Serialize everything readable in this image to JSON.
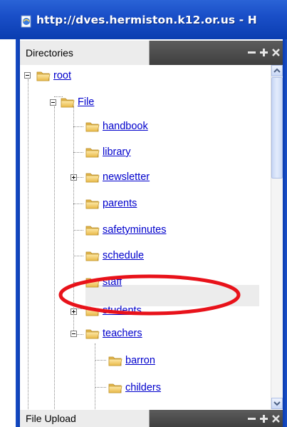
{
  "window": {
    "title": "http://dves.hermiston.k12.or.us - H"
  },
  "panels": {
    "directories": {
      "label": "Directories"
    },
    "file_upload": {
      "label": "File Upload"
    }
  },
  "tree": {
    "root": {
      "label": "root",
      "expanded": true
    },
    "file": {
      "label": "File",
      "expanded": true
    },
    "children": [
      {
        "label": "handbook",
        "toggle": "none"
      },
      {
        "label": "library",
        "toggle": "none"
      },
      {
        "label": "newsletter",
        "toggle": "collapsed"
      },
      {
        "label": "parents",
        "toggle": "none"
      },
      {
        "label": "safetyminutes",
        "toggle": "none"
      },
      {
        "label": "schedule",
        "toggle": "none"
      },
      {
        "label": "staff",
        "toggle": "none"
      },
      {
        "label": "students",
        "toggle": "collapsed"
      },
      {
        "label": "teachers",
        "toggle": "expanded"
      }
    ],
    "teachers_children": [
      {
        "label": "barron",
        "selected": true
      },
      {
        "label": "childers",
        "selected": false
      }
    ]
  },
  "icons": {
    "title": "ie-page-icon",
    "folder": "folder-icon",
    "minimize": "minus-icon",
    "move": "move-cross-icon",
    "close": "close-x-icon"
  },
  "colors": {
    "titlebar": "#1a4fc8",
    "link": "#0000cc",
    "folder": "#f3cf6a",
    "annotation": "#e8121a"
  }
}
